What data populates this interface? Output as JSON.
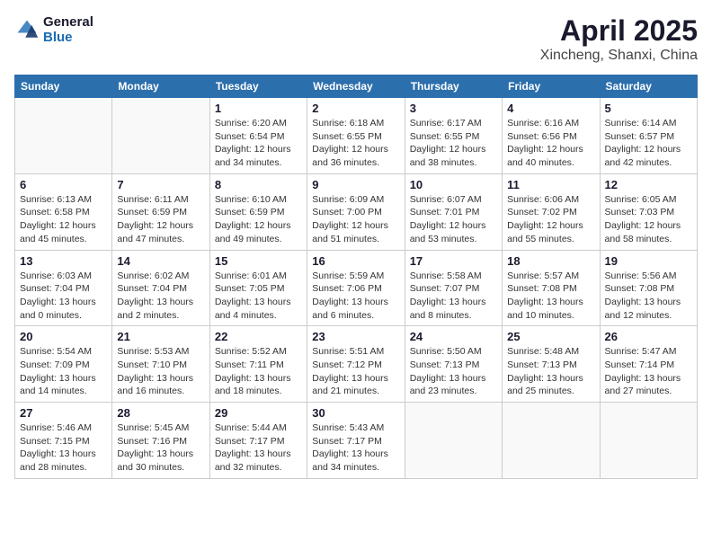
{
  "header": {
    "logo_general": "General",
    "logo_blue": "Blue",
    "month": "April 2025",
    "location": "Xincheng, Shanxi, China"
  },
  "weekdays": [
    "Sunday",
    "Monday",
    "Tuesday",
    "Wednesday",
    "Thursday",
    "Friday",
    "Saturday"
  ],
  "weeks": [
    [
      {
        "day": null
      },
      {
        "day": null
      },
      {
        "day": "1",
        "sunrise": "Sunrise: 6:20 AM",
        "sunset": "Sunset: 6:54 PM",
        "daylight": "Daylight: 12 hours and 34 minutes."
      },
      {
        "day": "2",
        "sunrise": "Sunrise: 6:18 AM",
        "sunset": "Sunset: 6:55 PM",
        "daylight": "Daylight: 12 hours and 36 minutes."
      },
      {
        "day": "3",
        "sunrise": "Sunrise: 6:17 AM",
        "sunset": "Sunset: 6:55 PM",
        "daylight": "Daylight: 12 hours and 38 minutes."
      },
      {
        "day": "4",
        "sunrise": "Sunrise: 6:16 AM",
        "sunset": "Sunset: 6:56 PM",
        "daylight": "Daylight: 12 hours and 40 minutes."
      },
      {
        "day": "5",
        "sunrise": "Sunrise: 6:14 AM",
        "sunset": "Sunset: 6:57 PM",
        "daylight": "Daylight: 12 hours and 42 minutes."
      }
    ],
    [
      {
        "day": "6",
        "sunrise": "Sunrise: 6:13 AM",
        "sunset": "Sunset: 6:58 PM",
        "daylight": "Daylight: 12 hours and 45 minutes."
      },
      {
        "day": "7",
        "sunrise": "Sunrise: 6:11 AM",
        "sunset": "Sunset: 6:59 PM",
        "daylight": "Daylight: 12 hours and 47 minutes."
      },
      {
        "day": "8",
        "sunrise": "Sunrise: 6:10 AM",
        "sunset": "Sunset: 6:59 PM",
        "daylight": "Daylight: 12 hours and 49 minutes."
      },
      {
        "day": "9",
        "sunrise": "Sunrise: 6:09 AM",
        "sunset": "Sunset: 7:00 PM",
        "daylight": "Daylight: 12 hours and 51 minutes."
      },
      {
        "day": "10",
        "sunrise": "Sunrise: 6:07 AM",
        "sunset": "Sunset: 7:01 PM",
        "daylight": "Daylight: 12 hours and 53 minutes."
      },
      {
        "day": "11",
        "sunrise": "Sunrise: 6:06 AM",
        "sunset": "Sunset: 7:02 PM",
        "daylight": "Daylight: 12 hours and 55 minutes."
      },
      {
        "day": "12",
        "sunrise": "Sunrise: 6:05 AM",
        "sunset": "Sunset: 7:03 PM",
        "daylight": "Daylight: 12 hours and 58 minutes."
      }
    ],
    [
      {
        "day": "13",
        "sunrise": "Sunrise: 6:03 AM",
        "sunset": "Sunset: 7:04 PM",
        "daylight": "Daylight: 13 hours and 0 minutes."
      },
      {
        "day": "14",
        "sunrise": "Sunrise: 6:02 AM",
        "sunset": "Sunset: 7:04 PM",
        "daylight": "Daylight: 13 hours and 2 minutes."
      },
      {
        "day": "15",
        "sunrise": "Sunrise: 6:01 AM",
        "sunset": "Sunset: 7:05 PM",
        "daylight": "Daylight: 13 hours and 4 minutes."
      },
      {
        "day": "16",
        "sunrise": "Sunrise: 5:59 AM",
        "sunset": "Sunset: 7:06 PM",
        "daylight": "Daylight: 13 hours and 6 minutes."
      },
      {
        "day": "17",
        "sunrise": "Sunrise: 5:58 AM",
        "sunset": "Sunset: 7:07 PM",
        "daylight": "Daylight: 13 hours and 8 minutes."
      },
      {
        "day": "18",
        "sunrise": "Sunrise: 5:57 AM",
        "sunset": "Sunset: 7:08 PM",
        "daylight": "Daylight: 13 hours and 10 minutes."
      },
      {
        "day": "19",
        "sunrise": "Sunrise: 5:56 AM",
        "sunset": "Sunset: 7:08 PM",
        "daylight": "Daylight: 13 hours and 12 minutes."
      }
    ],
    [
      {
        "day": "20",
        "sunrise": "Sunrise: 5:54 AM",
        "sunset": "Sunset: 7:09 PM",
        "daylight": "Daylight: 13 hours and 14 minutes."
      },
      {
        "day": "21",
        "sunrise": "Sunrise: 5:53 AM",
        "sunset": "Sunset: 7:10 PM",
        "daylight": "Daylight: 13 hours and 16 minutes."
      },
      {
        "day": "22",
        "sunrise": "Sunrise: 5:52 AM",
        "sunset": "Sunset: 7:11 PM",
        "daylight": "Daylight: 13 hours and 18 minutes."
      },
      {
        "day": "23",
        "sunrise": "Sunrise: 5:51 AM",
        "sunset": "Sunset: 7:12 PM",
        "daylight": "Daylight: 13 hours and 21 minutes."
      },
      {
        "day": "24",
        "sunrise": "Sunrise: 5:50 AM",
        "sunset": "Sunset: 7:13 PM",
        "daylight": "Daylight: 13 hours and 23 minutes."
      },
      {
        "day": "25",
        "sunrise": "Sunrise: 5:48 AM",
        "sunset": "Sunset: 7:13 PM",
        "daylight": "Daylight: 13 hours and 25 minutes."
      },
      {
        "day": "26",
        "sunrise": "Sunrise: 5:47 AM",
        "sunset": "Sunset: 7:14 PM",
        "daylight": "Daylight: 13 hours and 27 minutes."
      }
    ],
    [
      {
        "day": "27",
        "sunrise": "Sunrise: 5:46 AM",
        "sunset": "Sunset: 7:15 PM",
        "daylight": "Daylight: 13 hours and 28 minutes."
      },
      {
        "day": "28",
        "sunrise": "Sunrise: 5:45 AM",
        "sunset": "Sunset: 7:16 PM",
        "daylight": "Daylight: 13 hours and 30 minutes."
      },
      {
        "day": "29",
        "sunrise": "Sunrise: 5:44 AM",
        "sunset": "Sunset: 7:17 PM",
        "daylight": "Daylight: 13 hours and 32 minutes."
      },
      {
        "day": "30",
        "sunrise": "Sunrise: 5:43 AM",
        "sunset": "Sunset: 7:17 PM",
        "daylight": "Daylight: 13 hours and 34 minutes."
      },
      {
        "day": null
      },
      {
        "day": null
      },
      {
        "day": null
      }
    ]
  ]
}
